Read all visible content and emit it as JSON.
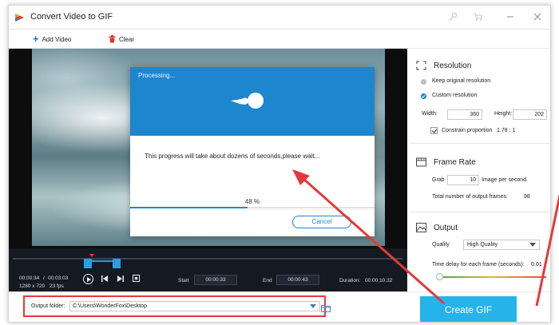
{
  "app": {
    "title": "Convert Video to GIF"
  },
  "toolbar": {
    "add_video": "Add Video",
    "clear": "Clear"
  },
  "dialog": {
    "title": "Processing...",
    "message": "This progress will take about dozens of seconds,please wait...",
    "progress_text": "48 %",
    "progress_fraction": 0.48,
    "cancel": "Cancel"
  },
  "timeline": {
    "current": "00:00:34",
    "separator": "/",
    "total": "00:03:03",
    "resolution": "1280 x 720",
    "fps": "23 fps",
    "start_label": "Start",
    "start_value": "00:00:33",
    "end_label": "End",
    "end_value": "00:00:43",
    "duration_label": "Duration:",
    "duration_value": "00:00:10.32"
  },
  "output": {
    "label": "Output folder:",
    "path": "C:\\Users\\WonderFox\\Desktop"
  },
  "create_button": "Create GIF",
  "settings": {
    "resolution": {
      "title": "Resolution",
      "option_original": "Keep original resolution",
      "option_custom": "Custom resolution",
      "width_label": "Width:",
      "width_value": "360",
      "height_label": "Height:",
      "height_value": "202",
      "constrain_label": "Constrain proportion",
      "ratio": "1.78 : 1"
    },
    "frame_rate": {
      "title": "Frame Rate",
      "grab_label": "Grab",
      "grab_value": "10",
      "per_second": "Image per second.",
      "total_label": "Total number of output frames:",
      "total_value": "98"
    },
    "output": {
      "title": "Output",
      "quality_label": "Quality",
      "quality_value": "High Quality",
      "delay_label": "Time delay for each frame (seconds):",
      "delay_value": "0.01",
      "delay_slider_fraction": 0.0
    }
  },
  "colors": {
    "accent": "#1d86cf",
    "create_button": "#25b4ea",
    "annotation_red": "#e33a3a"
  }
}
